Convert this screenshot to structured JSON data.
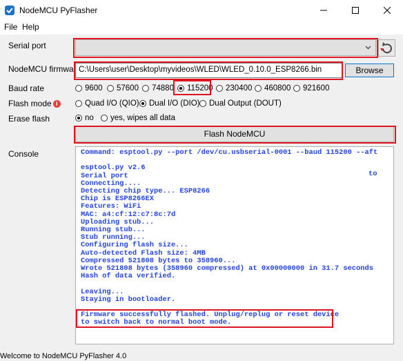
{
  "window": {
    "title": "NodeMCU PyFlasher",
    "controls": [
      "minimize-icon",
      "maximize-icon",
      "close-icon"
    ]
  },
  "menu": {
    "items": [
      "File",
      "Help"
    ]
  },
  "serial_port": {
    "label": "Serial port",
    "value": ""
  },
  "firmware": {
    "label": "NodeMCU firmware",
    "value": "C:\\Users\\user\\Desktop\\myvideos\\WLED\\WLED_0.10.0_ESP8266.bin",
    "browse_label": "Browse"
  },
  "baud_rate": {
    "label": "Baud rate",
    "options": [
      "9600",
      "57600",
      "74880",
      "115200",
      "230400",
      "460800",
      "921600"
    ],
    "selected": "115200"
  },
  "flash_mode": {
    "label": "Flash mode",
    "info_icon": "info-icon",
    "options": [
      "Quad I/O (QIO)",
      "Dual I/O (DIO)",
      "Dual Output (DOUT)"
    ],
    "selected": "Dual I/O (DIO)"
  },
  "erase_flash": {
    "label": "Erase flash",
    "options": [
      "no",
      "yes, wipes all data"
    ],
    "selected": "no"
  },
  "flash_button": {
    "label": "Flash NodeMCU"
  },
  "console": {
    "label": "Console",
    "text": "Command: esptool.py --port /dev/cu.usbserial-0001 --baud 115200 --aft\n\nesptool.py v2.6\nSerial port\nConnecting....\nDetecting chip type... ESP8266\nChip is ESP8266EX\nFeatures: WiFi\nMAC: a4:cf:12:c7:8c:7d\nUploading stub...\nRunning stub...\nStub running...\nConfiguring flash size...\nAuto-detected Flash size: 4MB\nCompressed 521808 bytes to 358960...\nWrote 521808 bytes (358960 compressed) at 0x00000000 in 31.7 seconds\nHash of data verified.\n\nLeaving...\nStaying in bootloader.\n\nFirmware successfully flashed. Unplug/replug or reset device\nto switch back to normal boot mode.",
    "overflow_text": "to"
  },
  "status_bar": {
    "text": "Welcome to NodeMCU PyFlasher 4.0"
  },
  "colors": {
    "console_text": "#2445d8",
    "highlight": "#e0141e",
    "accent": "#0078d7"
  }
}
